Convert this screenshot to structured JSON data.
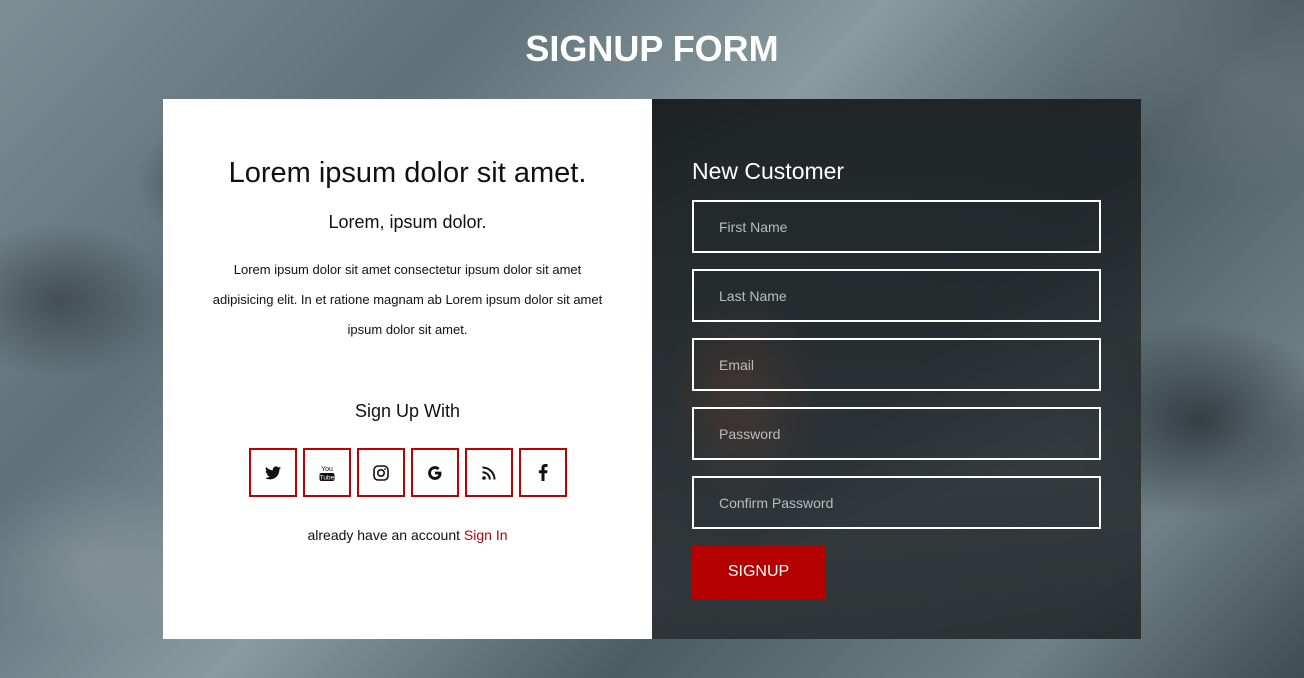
{
  "page": {
    "title": "SIGNUP FORM"
  },
  "info_panel": {
    "heading": "Lorem ipsum dolor sit amet.",
    "subheading": "Lorem, ipsum dolor.",
    "body": "Lorem ipsum dolor sit amet consectetur ipsum dolor sit amet adipisicing elit. In et ratione magnam ab Lorem ipsum dolor sit amet ipsum dolor sit amet.",
    "signup_with": "Sign Up With",
    "social": [
      {
        "name": "twitter-icon"
      },
      {
        "name": "youtube-icon"
      },
      {
        "name": "instagram-icon"
      },
      {
        "name": "google-icon"
      },
      {
        "name": "rss-icon"
      },
      {
        "name": "facebook-icon"
      }
    ],
    "account_text": "already have an account",
    "signin_label": "Sign In"
  },
  "form": {
    "title": "New Customer",
    "fields": {
      "first_name": {
        "placeholder": "First Name",
        "value": ""
      },
      "last_name": {
        "placeholder": "Last Name",
        "value": ""
      },
      "email": {
        "placeholder": "Email",
        "value": ""
      },
      "password": {
        "placeholder": "Password",
        "value": ""
      },
      "confirm_password": {
        "placeholder": "Confirm Password",
        "value": ""
      }
    },
    "submit_label": "SIGNUP"
  },
  "colors": {
    "accent": "#c00000",
    "button": "#b50000",
    "title": "#ffffff"
  }
}
